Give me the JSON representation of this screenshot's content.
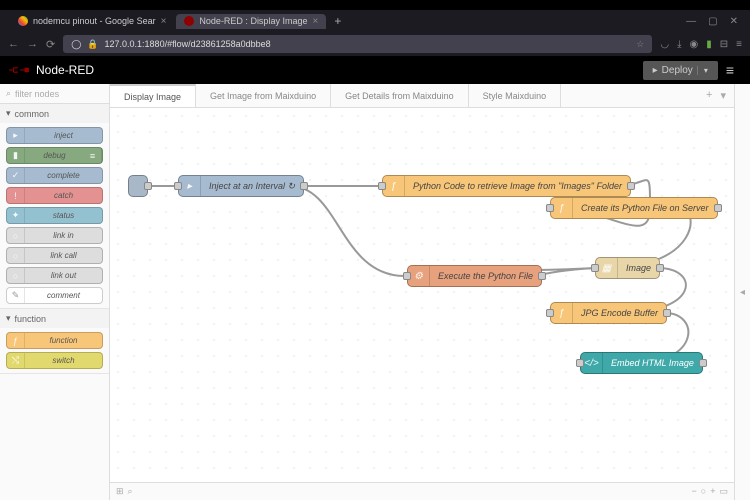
{
  "browser": {
    "tabs": [
      {
        "title": "nodemcu pinout - Google Sear",
        "active": false
      },
      {
        "title": "Node-RED : Display Image",
        "active": true
      }
    ],
    "url": "127.0.0.1:1880/#flow/d23861258a0dbbe8"
  },
  "app_title": "Node-RED",
  "deploy_label": "Deploy",
  "filter_placeholder": "filter nodes",
  "palette": {
    "common": {
      "label": "common",
      "nodes": [
        "inject",
        "debug",
        "complete",
        "catch",
        "status",
        "link in",
        "link call",
        "link out",
        "comment"
      ]
    },
    "function": {
      "label": "function",
      "nodes": [
        "function",
        "switch"
      ]
    }
  },
  "ws_tabs": [
    "Display Image",
    "Get Image from Maixduino",
    "Get Details from Maixduino",
    "Style Maixduino"
  ],
  "flow_nodes": {
    "trigger": "",
    "inject": "Inject at an Interval ↻",
    "retrieve": "Python Code to retrieve Image from \"Images\" Folder",
    "create": "Create its Python File on Server",
    "execute": "Execute the Python File",
    "image": "Image",
    "jpg": "JPG Encode Buffer",
    "html": "Embed HTML Image"
  }
}
